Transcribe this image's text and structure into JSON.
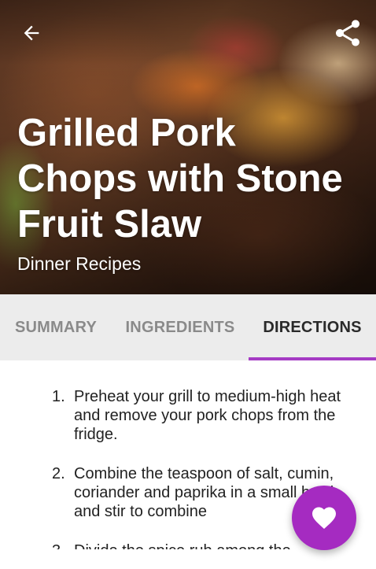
{
  "header": {
    "title": "Grilled Pork Chops with Stone Fruit Slaw",
    "subtitle": "Dinner Recipes",
    "back_icon": "arrow-left-icon",
    "share_icon": "share-icon"
  },
  "tabs": [
    {
      "label": "SUMMARY",
      "active": false
    },
    {
      "label": "INGREDIENTS",
      "active": false
    },
    {
      "label": "DIRECTIONS",
      "active": true
    }
  ],
  "colors": {
    "accent": "#a53bc4",
    "fab": "#a52bc1",
    "tab_bar": "#ececec",
    "tab_inactive": "#8a8a8a",
    "tab_active": "#2a2a2a"
  },
  "directions": [
    {
      "number": "1.",
      "text": "Preheat your grill to medium-high heat and remove your pork chops from the fridge."
    },
    {
      "number": "2.",
      "text": "Combine the teaspoon of salt, cumin, coriander and paprika in a small bowl and stir to combine"
    },
    {
      "number": "3.",
      "text": "Divide the spice rub among the"
    }
  ],
  "fab": {
    "icon": "heart-icon"
  }
}
